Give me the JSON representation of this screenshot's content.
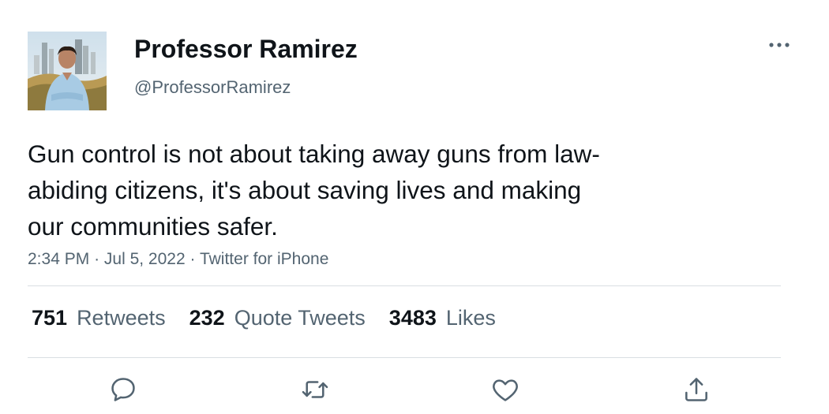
{
  "author": {
    "display_name": "Professor Ramirez",
    "handle": "@ProfessorRamirez",
    "avatar_icon": "profile-photo"
  },
  "tweet": {
    "text": "Gun control is not about taking away guns from law-abiding citizens, it's about saving lives and making our communities safer.",
    "text_lines": [
      "Gun control is not about taking away guns from law-",
      "abiding citizens, it's about saving lives and making",
      "our communities safer."
    ],
    "time": "2:34 PM",
    "date": "Jul 5, 2022",
    "source": "Twitter for iPhone",
    "separator": "·"
  },
  "stats": {
    "retweets_count": "751",
    "retweets_label": "Retweets",
    "quote_tweets_count": "232",
    "quote_tweets_label": "Quote Tweets",
    "likes_count": "3483",
    "likes_label": "Likes"
  },
  "actions": [
    "reply-icon",
    "retweet-icon",
    "like-icon",
    "share-icon"
  ],
  "colors": {
    "text_primary": "#0f1419",
    "text_secondary": "#536471",
    "divider": "#d9dee2"
  }
}
